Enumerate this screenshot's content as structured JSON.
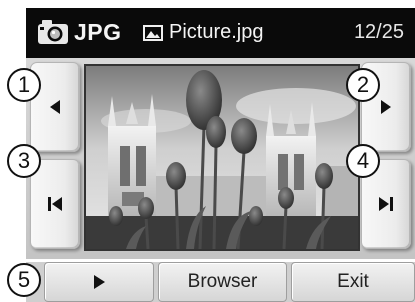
{
  "header": {
    "format": "JPG",
    "filename": "Picture.jpg",
    "counter": "12/25",
    "app_icon": "camera-icon",
    "file_icon": "image-file-icon"
  },
  "navigation": {
    "prev_icon": "triangle-left-icon",
    "next_icon": "triangle-right-icon",
    "first_icon": "skip-first-icon",
    "last_icon": "skip-last-icon"
  },
  "toolbar": {
    "play_icon": "play-icon",
    "browser_label": "Browser",
    "exit_label": "Exit"
  },
  "callouts": [
    "1",
    "2",
    "3",
    "4",
    "5"
  ],
  "colors": {
    "header_bg": "#0a0a0a",
    "header_text": "#f4f4f4",
    "content_bg": "#c8c8c8",
    "button_face": "#eeeeee"
  }
}
